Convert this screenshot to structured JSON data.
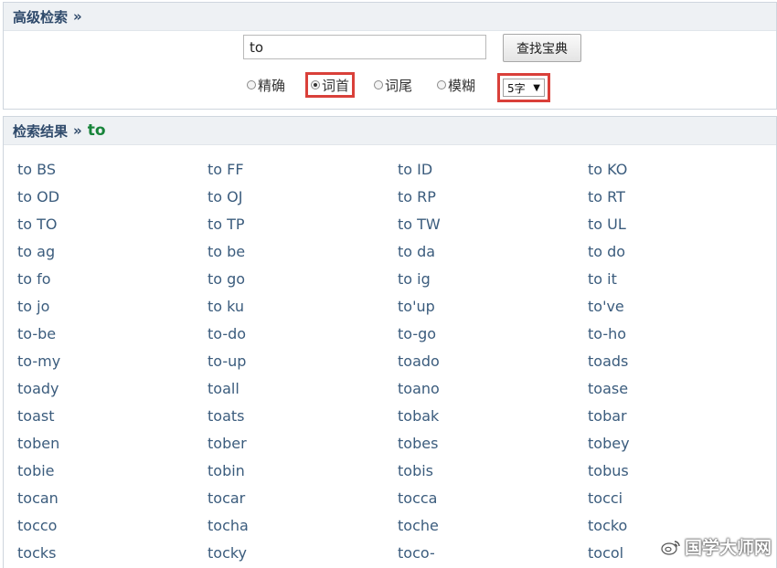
{
  "search": {
    "header_title": "高级检索",
    "raquo": "»",
    "query_value": "to",
    "button_label": "查找宝典",
    "options": {
      "exact": "精确",
      "prefix": "词首",
      "suffix": "词尾",
      "fuzzy": "模糊"
    },
    "selected_option": "词首",
    "length_select": "5字",
    "length_caret": "▼"
  },
  "results": {
    "header_title": "检索结果",
    "raquo": "»",
    "keyword": "to",
    "words": [
      "to BS",
      "to FF",
      "to ID",
      "to KO",
      "to OD",
      "to OJ",
      "to RP",
      "to RT",
      "to TO",
      "to TP",
      "to TW",
      "to UL",
      "to ag",
      "to be",
      "to da",
      "to do",
      "to fo",
      "to go",
      "to ig",
      "to it",
      "to jo",
      "to ku",
      "to'up",
      "to've",
      "to-be",
      "to-do",
      "to-go",
      "to-ho",
      "to-my",
      "to-up",
      "toado",
      "toads",
      "toady",
      "toall",
      "toano",
      "toase",
      "toast",
      "toats",
      "tobak",
      "tobar",
      "toben",
      "tober",
      "tobes",
      "tobey",
      "tobie",
      "tobin",
      "tobis",
      "tobus",
      "tocan",
      "tocar",
      "tocca",
      "tocci",
      "tocco",
      "tocha",
      "toche",
      "tocko",
      "tocks",
      "tocky",
      "toco-",
      "tocol"
    ]
  },
  "watermark": {
    "text": "国学大师网",
    "icon": "weibo-icon"
  },
  "colors": {
    "highlight": "#d9403a",
    "keyword": "#17843a",
    "link": "#3b5c7d",
    "header_bg": "#eef1f4"
  }
}
